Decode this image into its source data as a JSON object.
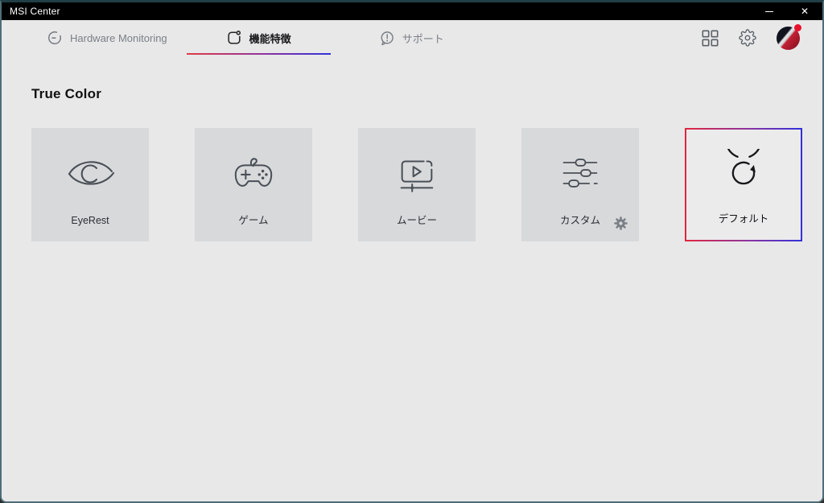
{
  "window": {
    "title": "MSI Center",
    "close_glyph": "✕"
  },
  "nav": {
    "tabs": [
      {
        "label": "Hardware Monitoring",
        "icon": "gauge-icon",
        "active": false
      },
      {
        "label": "機能特徴",
        "icon": "features-icon",
        "active": true
      },
      {
        "label": "サポート",
        "icon": "support-icon",
        "active": false
      }
    ]
  },
  "header_actions": {
    "apps_icon": "apps-grid-icon",
    "settings_icon": "settings-gear-icon",
    "avatar": "msi-user-avatar",
    "notification": true
  },
  "section": {
    "title": "True Color"
  },
  "cards": [
    {
      "label": "EyeRest",
      "icon": "eye-icon",
      "selected": false
    },
    {
      "label": "ゲーム",
      "icon": "gamepad-icon",
      "selected": false
    },
    {
      "label": "ムービー",
      "icon": "movie-player-icon",
      "selected": false
    },
    {
      "label": "カスタム",
      "icon": "sliders-icon",
      "selected": false,
      "has_settings": true
    },
    {
      "label": "デフォルト",
      "icon": "reset-refresh-icon",
      "selected": true
    }
  ],
  "colors": {
    "titlebar": "#000000",
    "page_bg": "#e8e8e9",
    "card_bg": "#d8d9db",
    "selected_card_bg": "#ebebec",
    "accent_red": "#e0263f",
    "accent_blue": "#3231d9",
    "icon_stroke": "#4a5057",
    "inactive_tab_text": "#7b8086",
    "notification_dot": "#e8112d",
    "window_border": "#4e6e79"
  }
}
